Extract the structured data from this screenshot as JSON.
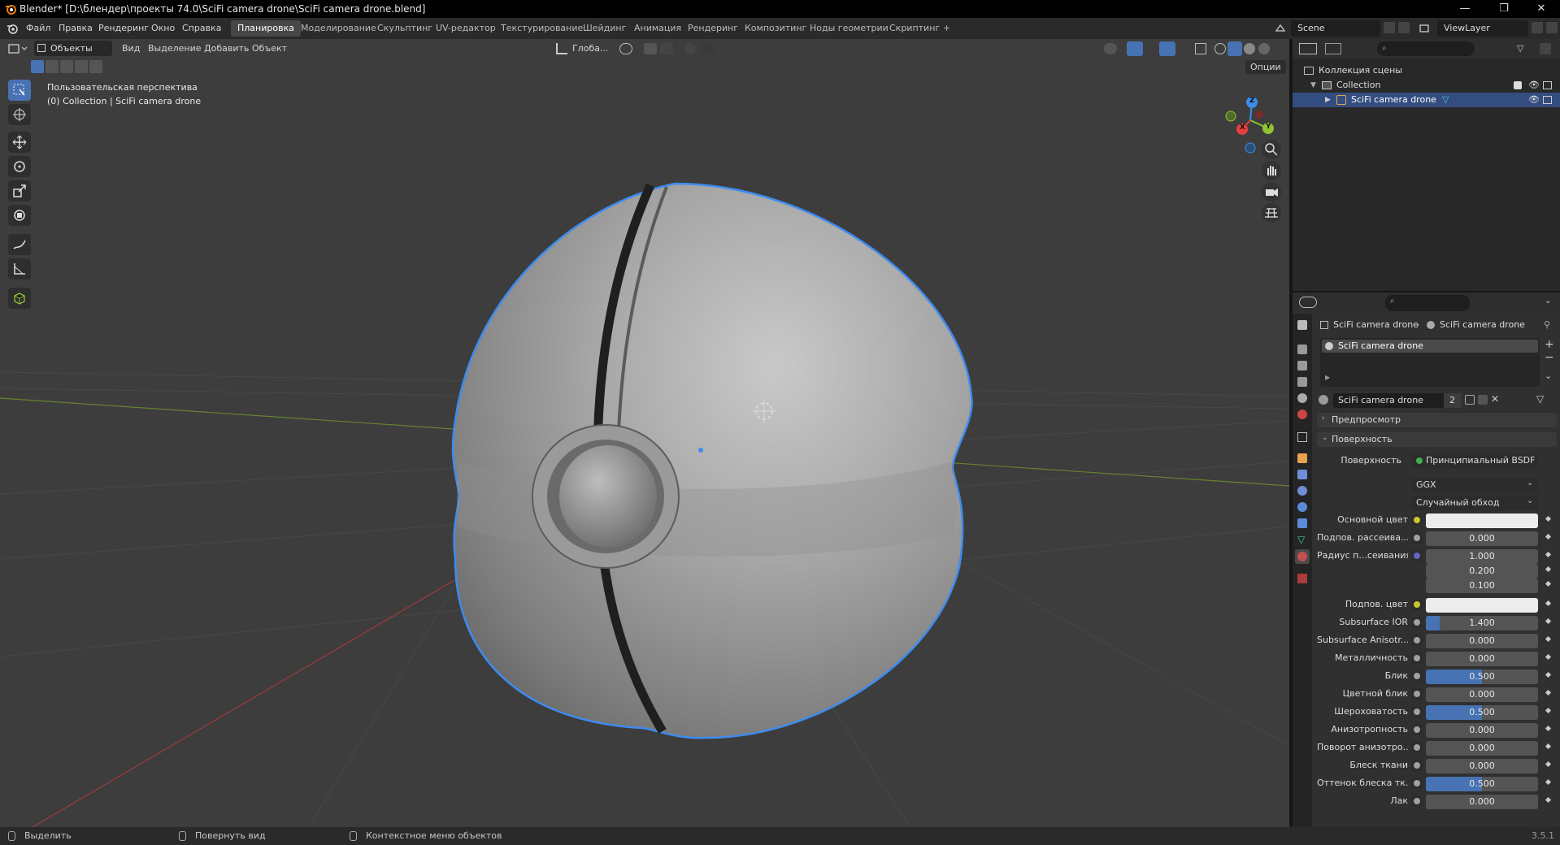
{
  "window": {
    "title": "Blender* [D:\\блендер\\проекты 74.0\\SciFi camera drone\\SciFi camera drone.blend]",
    "minimize": "—",
    "restore": "❐",
    "close": "✕"
  },
  "menu": [
    "Файл",
    "Правка",
    "Рендеринг",
    "Окно",
    "Справка"
  ],
  "workspaces": [
    "Планировка",
    "Моделирование",
    "Скульптинг",
    "UV-редактор",
    "Текстурирование",
    "Шейдинг",
    "Анимация",
    "Рендеринг",
    "Композитинг",
    "Ноды геометрии",
    "Скриптинг",
    "+"
  ],
  "active_workspace": "Планировка",
  "scene": {
    "label": "Scene",
    "view_layer": "ViewLayer"
  },
  "viewport": {
    "mode": "Объекты",
    "menu": [
      "Вид",
      "Выделение",
      "Добавить",
      "Объект"
    ],
    "transform_orientation": "Глоба...",
    "options": "Опции",
    "perspective": "Пользовательская перспектива",
    "collection_info": "(0) Collection | SciFi camera drone",
    "gizmo": {
      "x": "X",
      "y": "Y",
      "z": "Z"
    }
  },
  "outliner": {
    "search_placeholder": "",
    "scene_collection": "Коллекция сцены",
    "collection": "Collection",
    "object": "SciFi camera drone"
  },
  "properties": {
    "breadcrumb_object": "SciFi camera drone",
    "breadcrumb_material": "SciFi camera drone",
    "slot": "SciFi camera drone",
    "material_name": "SciFi camera drone",
    "material_users": "2",
    "panel_preview": "Предпросмотр",
    "panel_surface": "Поверхность",
    "surface_label": "Поверхность",
    "surface_shader": "Принципиальный BSDF",
    "distribution": "GGX",
    "subsurface_method": "Случайный обход",
    "rows": [
      {
        "label": "Основной цвет",
        "value": "",
        "type": "color",
        "dot": "#c7c729"
      },
      {
        "label": "Подпов. рассеива...",
        "value": "0.000",
        "fill": 0,
        "dot": "#a0a0a0"
      },
      {
        "label": "Радиус п...сеивания",
        "value": "1.000",
        "fill": 0,
        "dot": "#6363c7"
      },
      {
        "label": "",
        "value": "0.200",
        "fill": 0
      },
      {
        "label": "",
        "value": "0.100",
        "fill": 0
      },
      {
        "label": "Подпов. цвет",
        "value": "",
        "type": "color",
        "dot": "#c7c729"
      },
      {
        "label": "Subsurface IOR",
        "value": "1.400",
        "fill": 0.12,
        "dot": "#a0a0a0"
      },
      {
        "label": "Subsurface Anisotr...",
        "value": "0.000",
        "fill": 0,
        "dot": "#a0a0a0"
      },
      {
        "label": "Металличность",
        "value": "0.000",
        "fill": 0,
        "dot": "#a0a0a0"
      },
      {
        "label": "Блик",
        "value": "0.500",
        "fill": 0.5,
        "dot": "#a0a0a0"
      },
      {
        "label": "Цветной блик",
        "value": "0.000",
        "fill": 0,
        "dot": "#a0a0a0"
      },
      {
        "label": "Шероховатость",
        "value": "0.500",
        "fill": 0.5,
        "dot": "#a0a0a0"
      },
      {
        "label": "Анизотропность",
        "value": "0.000",
        "fill": 0,
        "dot": "#a0a0a0"
      },
      {
        "label": "Поворот анизотро...",
        "value": "0.000",
        "fill": 0,
        "dot": "#a0a0a0"
      },
      {
        "label": "Блеск ткани",
        "value": "0.000",
        "fill": 0,
        "dot": "#a0a0a0"
      },
      {
        "label": "Оттенок блеска тк...",
        "value": "0.500",
        "fill": 0.5,
        "dot": "#a0a0a0"
      },
      {
        "label": "Лак",
        "value": "0.000",
        "fill": 0,
        "dot": "#a0a0a0"
      }
    ]
  },
  "statusbar": {
    "select": "Выделить",
    "rotate": "Повернуть вид",
    "context": "Контекстное меню объектов",
    "version": "3.5.1"
  },
  "colors": {
    "accent": "#4772b3",
    "selection_outline": "#3c8cf0",
    "x_axis": "#e83d3d",
    "y_axis": "#8fc234",
    "z_axis": "#3d8ce8"
  }
}
